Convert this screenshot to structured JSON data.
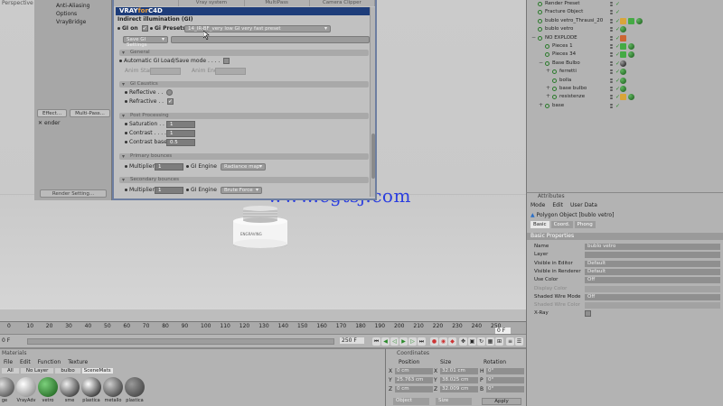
{
  "viewport": {
    "label": "Perspective",
    "watermark": "www.cgtsj.com",
    "bulb_text": "ENGRAVING"
  },
  "left_panel": {
    "items": [
      "Anti-Aliasing",
      "Options",
      "VrayBridge"
    ],
    "effect_btn": "Effect...",
    "multipass_btn": "Multi-Pass...",
    "sub_item": "ender",
    "render_settings": "Render Setting..."
  },
  "vray": {
    "tabs": [
      "",
      "Vray system",
      "MultiPass",
      "Camera Clipper"
    ],
    "logo_a": "VRAY",
    "logo_b": "for",
    "logo_c": "C4D",
    "subtitle": "Indirect illumination (GI)",
    "gi_on": "GI on",
    "gi_presets": "Gi Presets",
    "gi_preset_value": "14_IR-BF_very low GI very fast preset",
    "save_gi": "Save GI Settings",
    "general": "General",
    "auto_gi": "Automatic GI Load/Save mode",
    "irrad_start": "Anim Start",
    "irrad_end": "Anim End",
    "gi_caustics": "GI Caustics",
    "reflective": "Reflective",
    "refractive": "Refractive",
    "post_processing": "Post Processing",
    "saturation_lbl": "Saturation",
    "saturation_val": "1",
    "contrast_lbl": "Contrast",
    "contrast_val": "1",
    "contrast_base_lbl": "Contrast base",
    "contrast_base_val": "0.5",
    "primary": "Primary bounces",
    "multiplier_lbl": "Multiplier",
    "primary_mult": "1",
    "gi_engine_lbl": "GI Engine",
    "primary_engine": "Radiance map",
    "secondary": "Secondary bounces",
    "secondary_mult": "1",
    "secondary_engine": "Brute Force"
  },
  "objects": [
    {
      "name": "Render Preset",
      "indent": 0,
      "exp": "",
      "tags": []
    },
    {
      "name": "Fracture Object",
      "indent": 0,
      "exp": "",
      "tags": []
    },
    {
      "name": "bublo vetro_Thrausi_20",
      "indent": 0,
      "exp": "",
      "tags": [
        "yellow",
        "green",
        "ball"
      ]
    },
    {
      "name": "bublo vetro",
      "indent": 0,
      "exp": "",
      "tags": [
        "ball"
      ]
    },
    {
      "name": "NO EXPLODE",
      "indent": 0,
      "exp": "−",
      "tags": [
        "red"
      ]
    },
    {
      "name": "Pieces 1",
      "indent": 1,
      "exp": "",
      "tags": [
        "green",
        "ball"
      ]
    },
    {
      "name": "Pieces 34",
      "indent": 1,
      "exp": "",
      "tags": [
        "green",
        "ball"
      ]
    },
    {
      "name": "Base Bulbo",
      "indent": 1,
      "exp": "−",
      "tags": [
        "dark"
      ]
    },
    {
      "name": "ferretti",
      "indent": 2,
      "exp": "+",
      "tags": [
        "ball"
      ]
    },
    {
      "name": "bolla",
      "indent": 2,
      "exp": "",
      "tags": [
        "ball"
      ]
    },
    {
      "name": "base bulbo",
      "indent": 2,
      "exp": "+",
      "tags": [
        "ball"
      ]
    },
    {
      "name": "resistenze",
      "indent": 2,
      "exp": "+",
      "tags": [
        "yellow",
        "ball"
      ]
    },
    {
      "name": "base",
      "indent": 1,
      "exp": "+",
      "tags": []
    }
  ],
  "attributes": {
    "title": "Attributes",
    "menu": [
      "Mode",
      "Edit",
      "User Data"
    ],
    "object_line": "Polygon Object [bublo vetro]",
    "tabs": [
      "Basic",
      "Coord.",
      "Phong"
    ],
    "section": "Basic Properties",
    "props": [
      {
        "label": "Name",
        "value": "bublo vetro",
        "dim": false
      },
      {
        "label": "Layer",
        "value": "",
        "dim": false
      },
      {
        "label": "Visible in Editor",
        "value": "Default",
        "dim": false
      },
      {
        "label": "Visible in Renderer",
        "value": "Default",
        "dim": false
      },
      {
        "label": "Use Color",
        "value": "Off",
        "dim": false
      },
      {
        "label": "Display Color",
        "value": "",
        "dim": true
      },
      {
        "label": "Shaded Wire Mode",
        "value": "Off",
        "dim": false
      },
      {
        "label": "Shaded Wire Color",
        "value": "",
        "dim": true
      },
      {
        "label": "X-Ray",
        "value": "",
        "dim": false
      }
    ]
  },
  "timeline": {
    "ticks": [
      "0",
      "10",
      "20",
      "30",
      "40",
      "50",
      "60",
      "70",
      "80",
      "90",
      "100",
      "110",
      "120",
      "130",
      "140",
      "150",
      "160",
      "170",
      "180",
      "190",
      "200",
      "210",
      "220",
      "230",
      "240",
      "250"
    ],
    "start_frame": "0 F",
    "end_frame": "250 F",
    "current_frame": "0 F"
  },
  "materials": {
    "title": "Materials",
    "menu": [
      "File",
      "Edit",
      "Function",
      "Texture"
    ],
    "filters": [
      "All",
      "No Layer",
      "bulbo",
      "SceneMats"
    ],
    "items": [
      "ge",
      "VrayAdv",
      "vetro",
      "sme",
      "plastica",
      "metallo",
      "plastica"
    ]
  },
  "coords": {
    "title": "Coordinates",
    "cols": [
      "Position",
      "Size",
      "Rotation"
    ],
    "rows": [
      {
        "axis": "X",
        "pos": "0 cm",
        "size": "32.01 cm",
        "rax": "H",
        "rot": "0°"
      },
      {
        "axis": "Y",
        "pos": "25.763 cm",
        "size": "38.025 cm",
        "rax": "P",
        "rot": "0°"
      },
      {
        "axis": "Z",
        "pos": "0 cm",
        "size": "32.009 cm",
        "rax": "B",
        "rot": "0°"
      }
    ],
    "mode1": "Object",
    "mode2": "Size",
    "apply": "Apply"
  }
}
